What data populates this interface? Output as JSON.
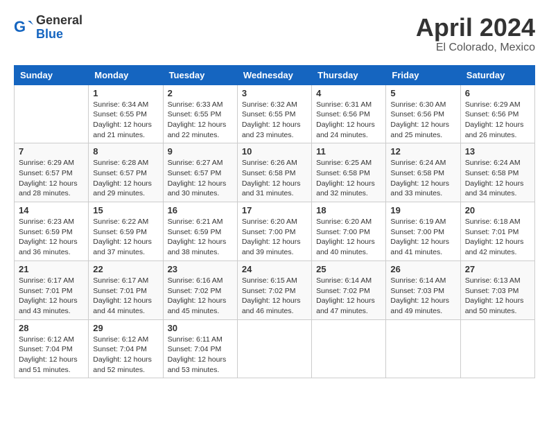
{
  "logo": {
    "general": "General",
    "blue": "Blue"
  },
  "title": "April 2024",
  "location": "El Colorado, Mexico",
  "days_of_week": [
    "Sunday",
    "Monday",
    "Tuesday",
    "Wednesday",
    "Thursday",
    "Friday",
    "Saturday"
  ],
  "weeks": [
    [
      {
        "day": "",
        "sunrise": "",
        "sunset": "",
        "daylight": ""
      },
      {
        "day": "1",
        "sunrise": "Sunrise: 6:34 AM",
        "sunset": "Sunset: 6:55 PM",
        "daylight": "Daylight: 12 hours and 21 minutes."
      },
      {
        "day": "2",
        "sunrise": "Sunrise: 6:33 AM",
        "sunset": "Sunset: 6:55 PM",
        "daylight": "Daylight: 12 hours and 22 minutes."
      },
      {
        "day": "3",
        "sunrise": "Sunrise: 6:32 AM",
        "sunset": "Sunset: 6:55 PM",
        "daylight": "Daylight: 12 hours and 23 minutes."
      },
      {
        "day": "4",
        "sunrise": "Sunrise: 6:31 AM",
        "sunset": "Sunset: 6:56 PM",
        "daylight": "Daylight: 12 hours and 24 minutes."
      },
      {
        "day": "5",
        "sunrise": "Sunrise: 6:30 AM",
        "sunset": "Sunset: 6:56 PM",
        "daylight": "Daylight: 12 hours and 25 minutes."
      },
      {
        "day": "6",
        "sunrise": "Sunrise: 6:29 AM",
        "sunset": "Sunset: 6:56 PM",
        "daylight": "Daylight: 12 hours and 26 minutes."
      }
    ],
    [
      {
        "day": "7",
        "sunrise": "Sunrise: 6:29 AM",
        "sunset": "Sunset: 6:57 PM",
        "daylight": "Daylight: 12 hours and 28 minutes."
      },
      {
        "day": "8",
        "sunrise": "Sunrise: 6:28 AM",
        "sunset": "Sunset: 6:57 PM",
        "daylight": "Daylight: 12 hours and 29 minutes."
      },
      {
        "day": "9",
        "sunrise": "Sunrise: 6:27 AM",
        "sunset": "Sunset: 6:57 PM",
        "daylight": "Daylight: 12 hours and 30 minutes."
      },
      {
        "day": "10",
        "sunrise": "Sunrise: 6:26 AM",
        "sunset": "Sunset: 6:58 PM",
        "daylight": "Daylight: 12 hours and 31 minutes."
      },
      {
        "day": "11",
        "sunrise": "Sunrise: 6:25 AM",
        "sunset": "Sunset: 6:58 PM",
        "daylight": "Daylight: 12 hours and 32 minutes."
      },
      {
        "day": "12",
        "sunrise": "Sunrise: 6:24 AM",
        "sunset": "Sunset: 6:58 PM",
        "daylight": "Daylight: 12 hours and 33 minutes."
      },
      {
        "day": "13",
        "sunrise": "Sunrise: 6:24 AM",
        "sunset": "Sunset: 6:58 PM",
        "daylight": "Daylight: 12 hours and 34 minutes."
      }
    ],
    [
      {
        "day": "14",
        "sunrise": "Sunrise: 6:23 AM",
        "sunset": "Sunset: 6:59 PM",
        "daylight": "Daylight: 12 hours and 36 minutes."
      },
      {
        "day": "15",
        "sunrise": "Sunrise: 6:22 AM",
        "sunset": "Sunset: 6:59 PM",
        "daylight": "Daylight: 12 hours and 37 minutes."
      },
      {
        "day": "16",
        "sunrise": "Sunrise: 6:21 AM",
        "sunset": "Sunset: 6:59 PM",
        "daylight": "Daylight: 12 hours and 38 minutes."
      },
      {
        "day": "17",
        "sunrise": "Sunrise: 6:20 AM",
        "sunset": "Sunset: 7:00 PM",
        "daylight": "Daylight: 12 hours and 39 minutes."
      },
      {
        "day": "18",
        "sunrise": "Sunrise: 6:20 AM",
        "sunset": "Sunset: 7:00 PM",
        "daylight": "Daylight: 12 hours and 40 minutes."
      },
      {
        "day": "19",
        "sunrise": "Sunrise: 6:19 AM",
        "sunset": "Sunset: 7:00 PM",
        "daylight": "Daylight: 12 hours and 41 minutes."
      },
      {
        "day": "20",
        "sunrise": "Sunrise: 6:18 AM",
        "sunset": "Sunset: 7:01 PM",
        "daylight": "Daylight: 12 hours and 42 minutes."
      }
    ],
    [
      {
        "day": "21",
        "sunrise": "Sunrise: 6:17 AM",
        "sunset": "Sunset: 7:01 PM",
        "daylight": "Daylight: 12 hours and 43 minutes."
      },
      {
        "day": "22",
        "sunrise": "Sunrise: 6:17 AM",
        "sunset": "Sunset: 7:01 PM",
        "daylight": "Daylight: 12 hours and 44 minutes."
      },
      {
        "day": "23",
        "sunrise": "Sunrise: 6:16 AM",
        "sunset": "Sunset: 7:02 PM",
        "daylight": "Daylight: 12 hours and 45 minutes."
      },
      {
        "day": "24",
        "sunrise": "Sunrise: 6:15 AM",
        "sunset": "Sunset: 7:02 PM",
        "daylight": "Daylight: 12 hours and 46 minutes."
      },
      {
        "day": "25",
        "sunrise": "Sunrise: 6:14 AM",
        "sunset": "Sunset: 7:02 PM",
        "daylight": "Daylight: 12 hours and 47 minutes."
      },
      {
        "day": "26",
        "sunrise": "Sunrise: 6:14 AM",
        "sunset": "Sunset: 7:03 PM",
        "daylight": "Daylight: 12 hours and 49 minutes."
      },
      {
        "day": "27",
        "sunrise": "Sunrise: 6:13 AM",
        "sunset": "Sunset: 7:03 PM",
        "daylight": "Daylight: 12 hours and 50 minutes."
      }
    ],
    [
      {
        "day": "28",
        "sunrise": "Sunrise: 6:12 AM",
        "sunset": "Sunset: 7:04 PM",
        "daylight": "Daylight: 12 hours and 51 minutes."
      },
      {
        "day": "29",
        "sunrise": "Sunrise: 6:12 AM",
        "sunset": "Sunset: 7:04 PM",
        "daylight": "Daylight: 12 hours and 52 minutes."
      },
      {
        "day": "30",
        "sunrise": "Sunrise: 6:11 AM",
        "sunset": "Sunset: 7:04 PM",
        "daylight": "Daylight: 12 hours and 53 minutes."
      },
      {
        "day": "",
        "sunrise": "",
        "sunset": "",
        "daylight": ""
      },
      {
        "day": "",
        "sunrise": "",
        "sunset": "",
        "daylight": ""
      },
      {
        "day": "",
        "sunrise": "",
        "sunset": "",
        "daylight": ""
      },
      {
        "day": "",
        "sunrise": "",
        "sunset": "",
        "daylight": ""
      }
    ]
  ]
}
